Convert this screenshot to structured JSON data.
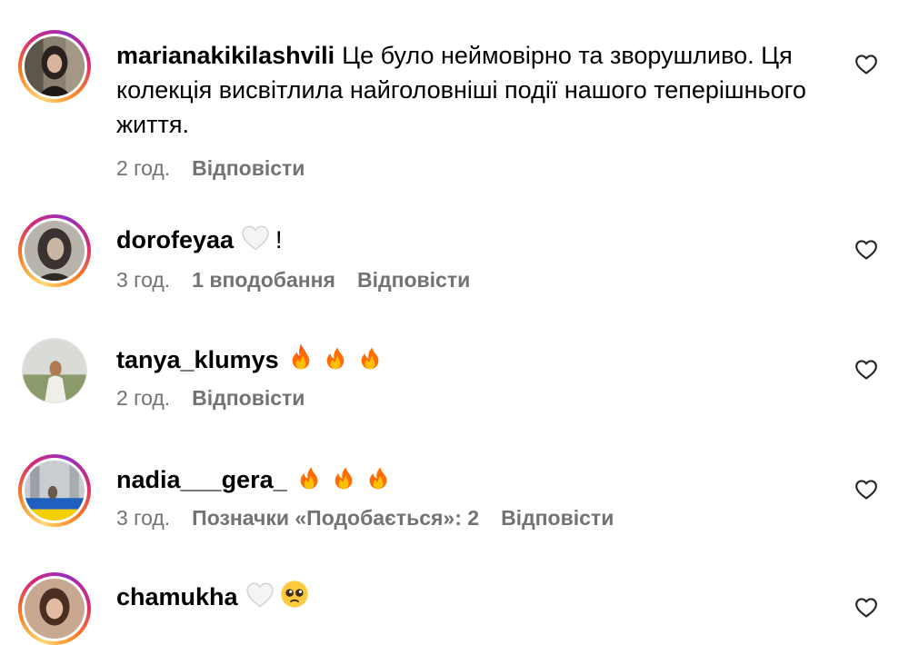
{
  "colors": {
    "text": "#000000",
    "meta": "#737373",
    "story_ring_start": "#feda75",
    "story_ring_end": "#d62976"
  },
  "comments": [
    {
      "username": "marianakikilashvili",
      "text": "Це було неймовірно та зворушливо. Ця колекція висвітлила найголовніші події нашого теперішнього життя.",
      "emojis": [],
      "time": "2 год.",
      "likes": "",
      "reply_label": "Відповісти",
      "has_story_ring": true,
      "like_icon": "heart-outline-icon"
    },
    {
      "username": "dorofeyaa",
      "text": "",
      "emojis": [
        "white-heart",
        "!"
      ],
      "time": "3 год.",
      "likes": "1 вподобання",
      "reply_label": "Відповісти",
      "has_story_ring": true,
      "like_icon": "heart-outline-icon"
    },
    {
      "username": "tanya_klumys",
      "text": "",
      "emojis": [
        "fire",
        "fire",
        "fire"
      ],
      "time": "2 год.",
      "likes": "",
      "reply_label": "Відповісти",
      "has_story_ring": false,
      "like_icon": "heart-outline-icon"
    },
    {
      "username": "nadia___gera_",
      "text": "",
      "emojis": [
        "fire",
        "fire",
        "fire"
      ],
      "time": "3 год.",
      "likes": "Позначки «Подобається»: 2",
      "reply_label": "Відповісти",
      "has_story_ring": true,
      "like_icon": "heart-outline-icon"
    },
    {
      "username": "chamukha",
      "text": "",
      "emojis": [
        "white-heart",
        "pleading-face"
      ],
      "time": "",
      "likes": "",
      "reply_label": "",
      "has_story_ring": true,
      "like_icon": "heart-outline-icon"
    }
  ]
}
